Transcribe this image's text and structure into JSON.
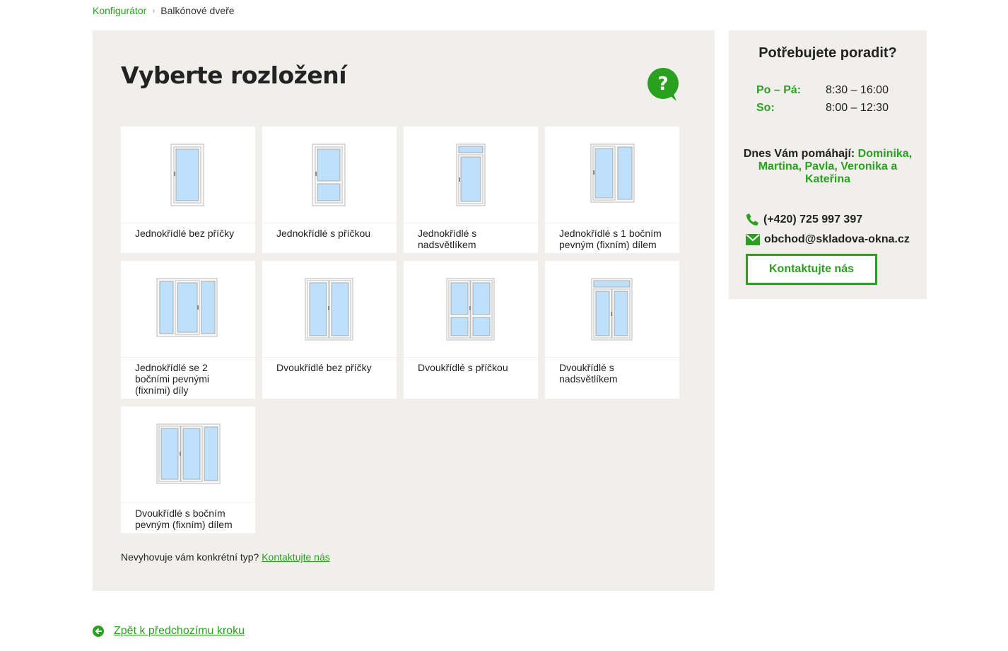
{
  "breadcrumb": {
    "root": "Konfigurátor",
    "current": "Balkónové dveře"
  },
  "main": {
    "title": "Vyberte rozložení",
    "tiles": [
      {
        "label": "Jednokřídlé bez příčky",
        "icon": "single-sash-door-icon"
      },
      {
        "label": "Jednokřídlé s příčkou",
        "icon": "single-sash-door-transom-bar-icon"
      },
      {
        "label": "Jednokřídlé s nadsvětlíkem",
        "icon": "single-sash-door-fanlight-icon"
      },
      {
        "label": "Jednokřídlé s 1 bočním pevným (fixním) dílem",
        "icon": "single-sash-door-side-fixed-icon"
      },
      {
        "label": "Jednokřídlé se 2 bočními pevnými (fixními) díly",
        "icon": "single-sash-door-two-side-fixed-icon"
      },
      {
        "label": "Dvoukřídlé bez příčky",
        "icon": "double-sash-door-icon"
      },
      {
        "label": "Dvoukřídlé s příčkou",
        "icon": "double-sash-door-transom-bar-icon"
      },
      {
        "label": "Dvoukřídlé s nadsvětlíkem",
        "icon": "double-sash-door-fanlight-icon"
      },
      {
        "label": "Dvoukřídlé s bočním pevným (fixním) dílem",
        "icon": "double-sash-door-side-fixed-icon"
      }
    ],
    "note_text": "Nevyhovuje vám konkrétní typ?",
    "note_link": "Kontaktujte nás"
  },
  "sidebar": {
    "title": "Potřebujete poradit?",
    "hours": [
      {
        "day": "Po – Pá:",
        "time": "8:30 – 16:00"
      },
      {
        "day": "So:",
        "time": "8:00 – 12:30"
      }
    ],
    "helpers_prefix": "Dnes Vám pomáhají:",
    "helpers_names": "Dominika, Martina, Pavla, Veronika a Kateřina",
    "phone": "(+420) 725 997 397",
    "email": "obchod@skladova-okna.cz",
    "contact_button": "Kontaktujte nás"
  },
  "footer": {
    "back_link": "Zpět k předchozímu kroku"
  },
  "colors": {
    "accent": "#2aa01f",
    "panel": "#f0efec",
    "glass": "#bfe0fa"
  }
}
